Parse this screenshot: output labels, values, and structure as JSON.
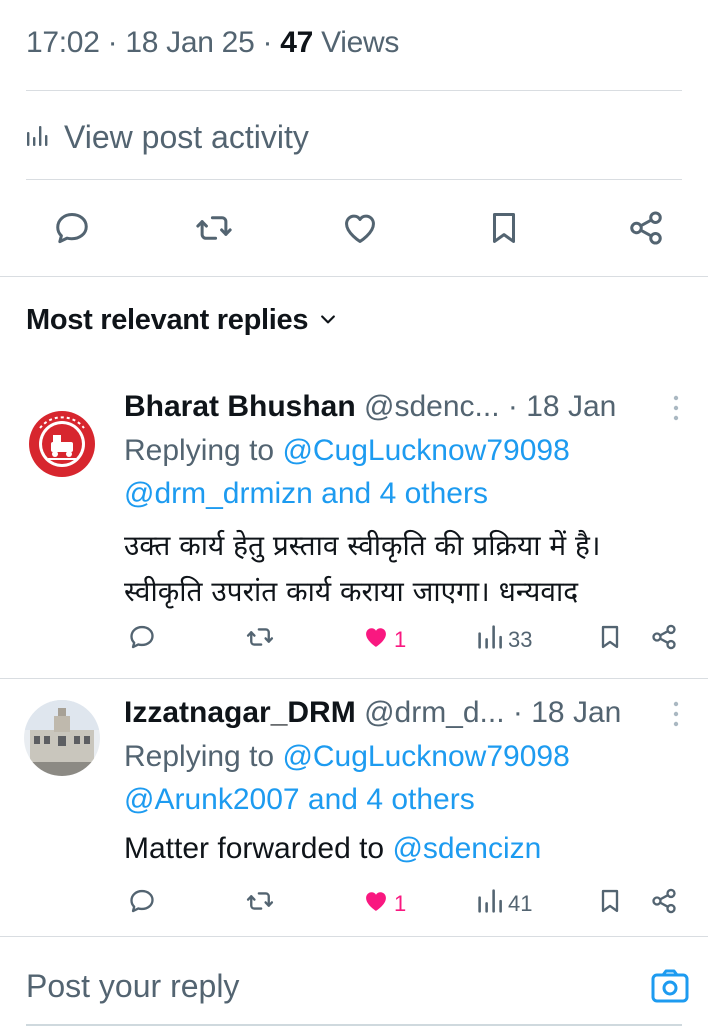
{
  "post_meta": {
    "time": "17:02",
    "separator": "·",
    "date": "18 Jan 25",
    "views_count": "47",
    "views_label": "Views"
  },
  "activity": {
    "label": "View post activity",
    "icon": "bar-chart-icon"
  },
  "action_bar": {
    "icons": [
      "reply-icon",
      "repost-icon",
      "like-icon",
      "bookmark-icon",
      "share-icon"
    ]
  },
  "replies_section": {
    "title": "Most relevant replies"
  },
  "replies": [
    {
      "name": "Bharat Bhushan",
      "handle": "@sdenc...",
      "separator": "·",
      "date": "18 Jan",
      "replying_prefix": "Replying to",
      "replying_to": "@CugLucknow79098",
      "replying_to_second": "@drm_drmizn",
      "replying_and": "and",
      "replying_others": "4 others",
      "text_lines": [
        "उक्त कार्य हेतु प्रस्ताव स्वीकृति की प्रक्रिया में है।",
        "स्वीकृति उपरांत कार्य कराया जाएगा। धन्यवाद"
      ],
      "stats": {
        "likes": "1",
        "views": "33"
      },
      "avatar": "indian-railways-logo"
    },
    {
      "name": "Izzatnagar_DRM",
      "handle": "@drm_d...",
      "separator": "·",
      "date": "18 Jan",
      "replying_prefix": "Replying to",
      "replying_to": "@CugLucknow79098",
      "replying_to_second": "@Arunk2007",
      "replying_and": "and",
      "replying_others": "4 others",
      "text_prefix": "Matter forwarded to",
      "text_mention": "@sdencizn",
      "stats": {
        "likes": "1",
        "views": "41"
      },
      "avatar": "building-photo"
    }
  ],
  "compose": {
    "placeholder": "Post your reply",
    "camera_icon": "camera-icon"
  },
  "colors": {
    "link": "#1d9bf0",
    "like": "#f91880",
    "muted": "#536471",
    "text": "#0f1419",
    "divider": "#d9dde1"
  }
}
